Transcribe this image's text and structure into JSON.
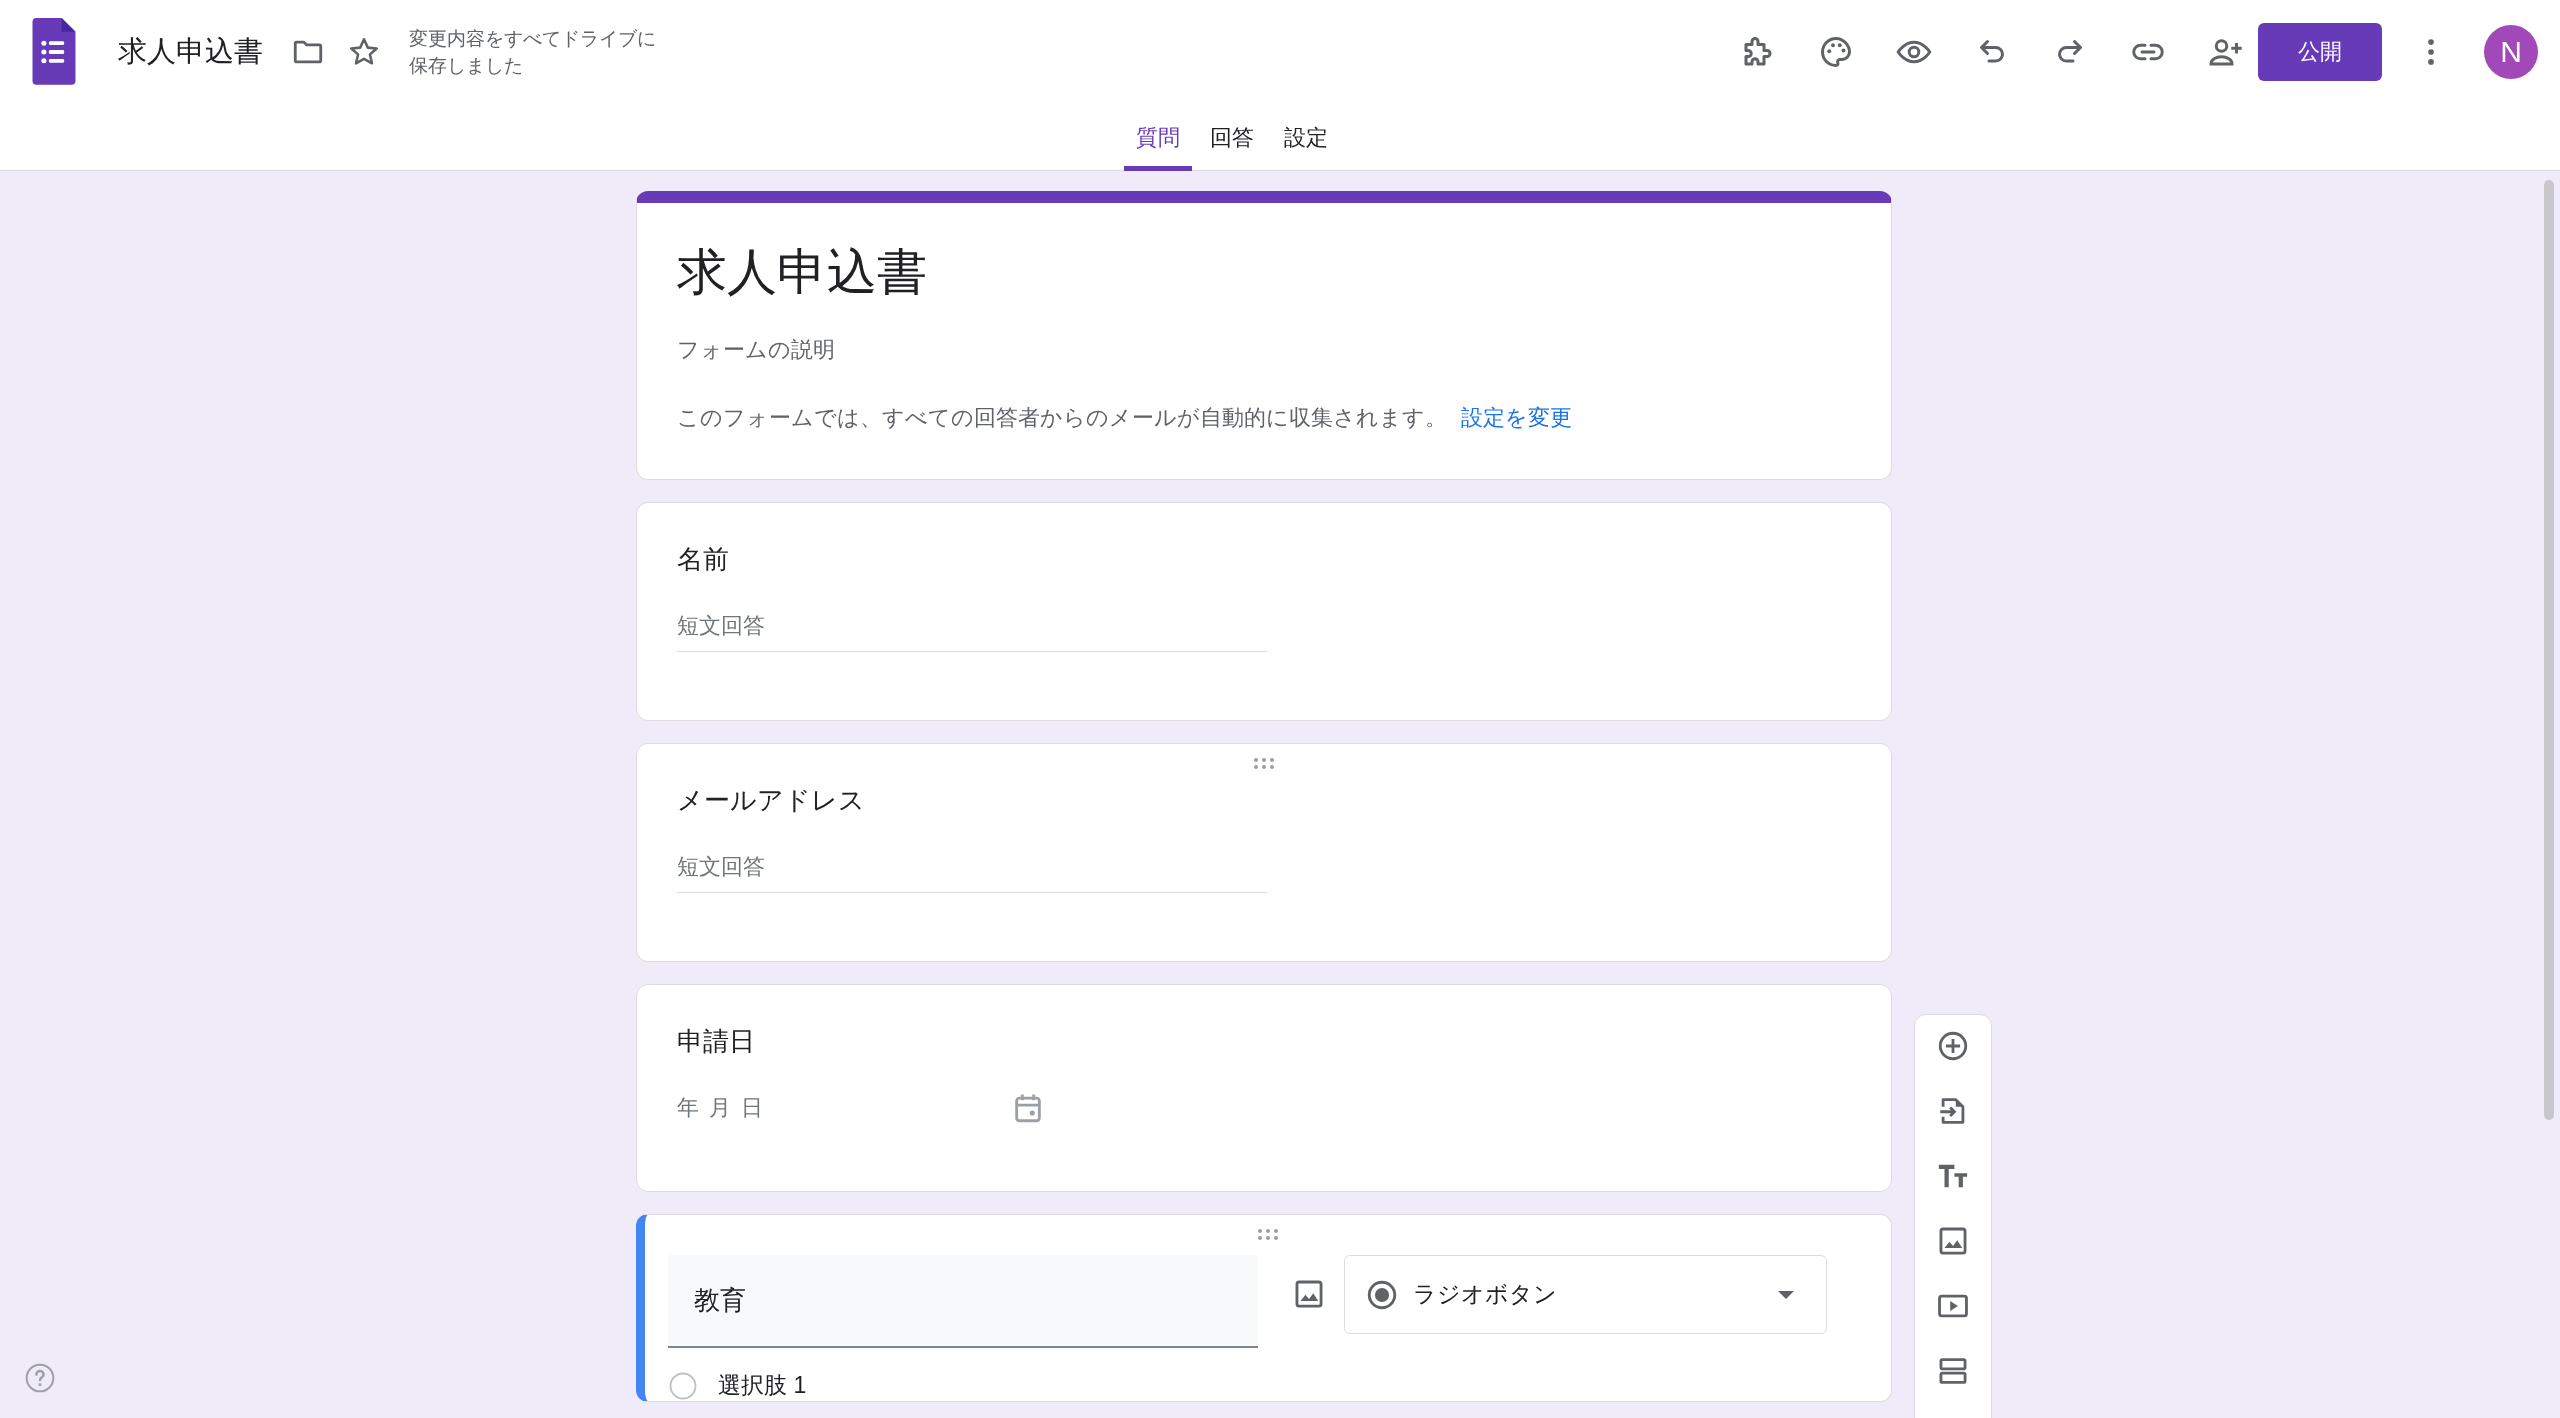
{
  "header": {
    "title": "求人申込書",
    "save_status": "変更内容をすべてドライブに保存しました",
    "publish_button": "公開",
    "avatar_initial": "N"
  },
  "tabs": [
    {
      "label": "質問",
      "selected": true
    },
    {
      "label": "回答",
      "selected": false
    },
    {
      "label": "設定",
      "selected": false
    }
  ],
  "form": {
    "title": "求人申込書",
    "description_placeholder": "フォームの説明",
    "notice": "このフォームでは、すべての回答者からのメールが自動的に収集されます。",
    "notice_link": "設定を変更"
  },
  "questions": [
    {
      "kind": "short_answer",
      "title": "名前",
      "placeholder": "短文回答",
      "active": false,
      "drag_handle": false
    },
    {
      "kind": "short_answer",
      "title": "メールアドレス",
      "placeholder": "短文回答",
      "active": false,
      "drag_handle": true
    },
    {
      "kind": "date",
      "title": "申請日",
      "placeholder": "年 月 日",
      "active": false,
      "drag_handle": false
    },
    {
      "kind": "multiple_choice",
      "title": "教育",
      "active": true,
      "drag_handle": true,
      "type_label": "ラジオボタン",
      "options": [
        {
          "label": "選択肢 1"
        }
      ]
    }
  ]
}
